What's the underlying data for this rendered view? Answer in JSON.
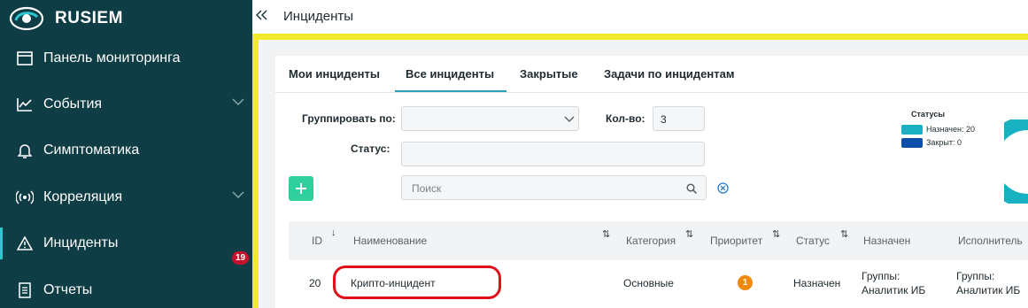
{
  "app": {
    "brand": "RUSIEM"
  },
  "sidebar": {
    "items": [
      {
        "label": "Панель мониторинга",
        "icon": "monitor-panel-icon"
      },
      {
        "label": "События",
        "icon": "chart-line-icon",
        "expandable": true
      },
      {
        "label": "Симптоматика",
        "icon": "bell-icon"
      },
      {
        "label": "Корреляция",
        "icon": "signal-icon",
        "expandable": true
      },
      {
        "label": "Инциденты",
        "icon": "warning-icon",
        "active": true,
        "badge": "19"
      },
      {
        "label": "Отчеты",
        "icon": "report-icon"
      }
    ]
  },
  "header": {
    "collapse_icon": "double-chevron-left-icon",
    "title": "Инциденты"
  },
  "tabs": [
    {
      "label": "Мои инциденты"
    },
    {
      "label": "Все инциденты",
      "active": true
    },
    {
      "label": "Закрытые"
    },
    {
      "label": "Задачи по инцидентам"
    }
  ],
  "filters": {
    "group_by_label": "Группировать по:",
    "group_by_value": "",
    "count_label": "Кол-во:",
    "count_value": "3",
    "status_label": "Статус:",
    "status_value": "",
    "search_placeholder": "Поиск"
  },
  "legend": {
    "title": "Статусы",
    "items": [
      {
        "label": "Назначен: 20",
        "color": "#17b1c1"
      },
      {
        "label": "Закрыт: 0",
        "color": "#0d4fa8"
      }
    ]
  },
  "table": {
    "columns": [
      "ID",
      "Наименование",
      "Категория",
      "Приоритет",
      "Статус",
      "Назначен",
      "Исполнитель"
    ],
    "rows": [
      {
        "id": "20",
        "name": "Крипто-инцидент",
        "category": "Основные",
        "priority": "1",
        "status": "Назначен",
        "assigned_line1": "Группы:",
        "assigned_line2": "Аналитик ИБ",
        "executor_line1": "Группы:",
        "executor_line2": "Аналитик ИБ"
      }
    ]
  },
  "colors": {
    "sidebar_bg": "#0f3d45",
    "accent": "#2aa0b6",
    "add_button": "#2fcf9e",
    "badge": "#c8102e",
    "priority_badge": "#f2890f",
    "highlight_frame": "#f0ea2b",
    "annotation": "#e0101a"
  }
}
